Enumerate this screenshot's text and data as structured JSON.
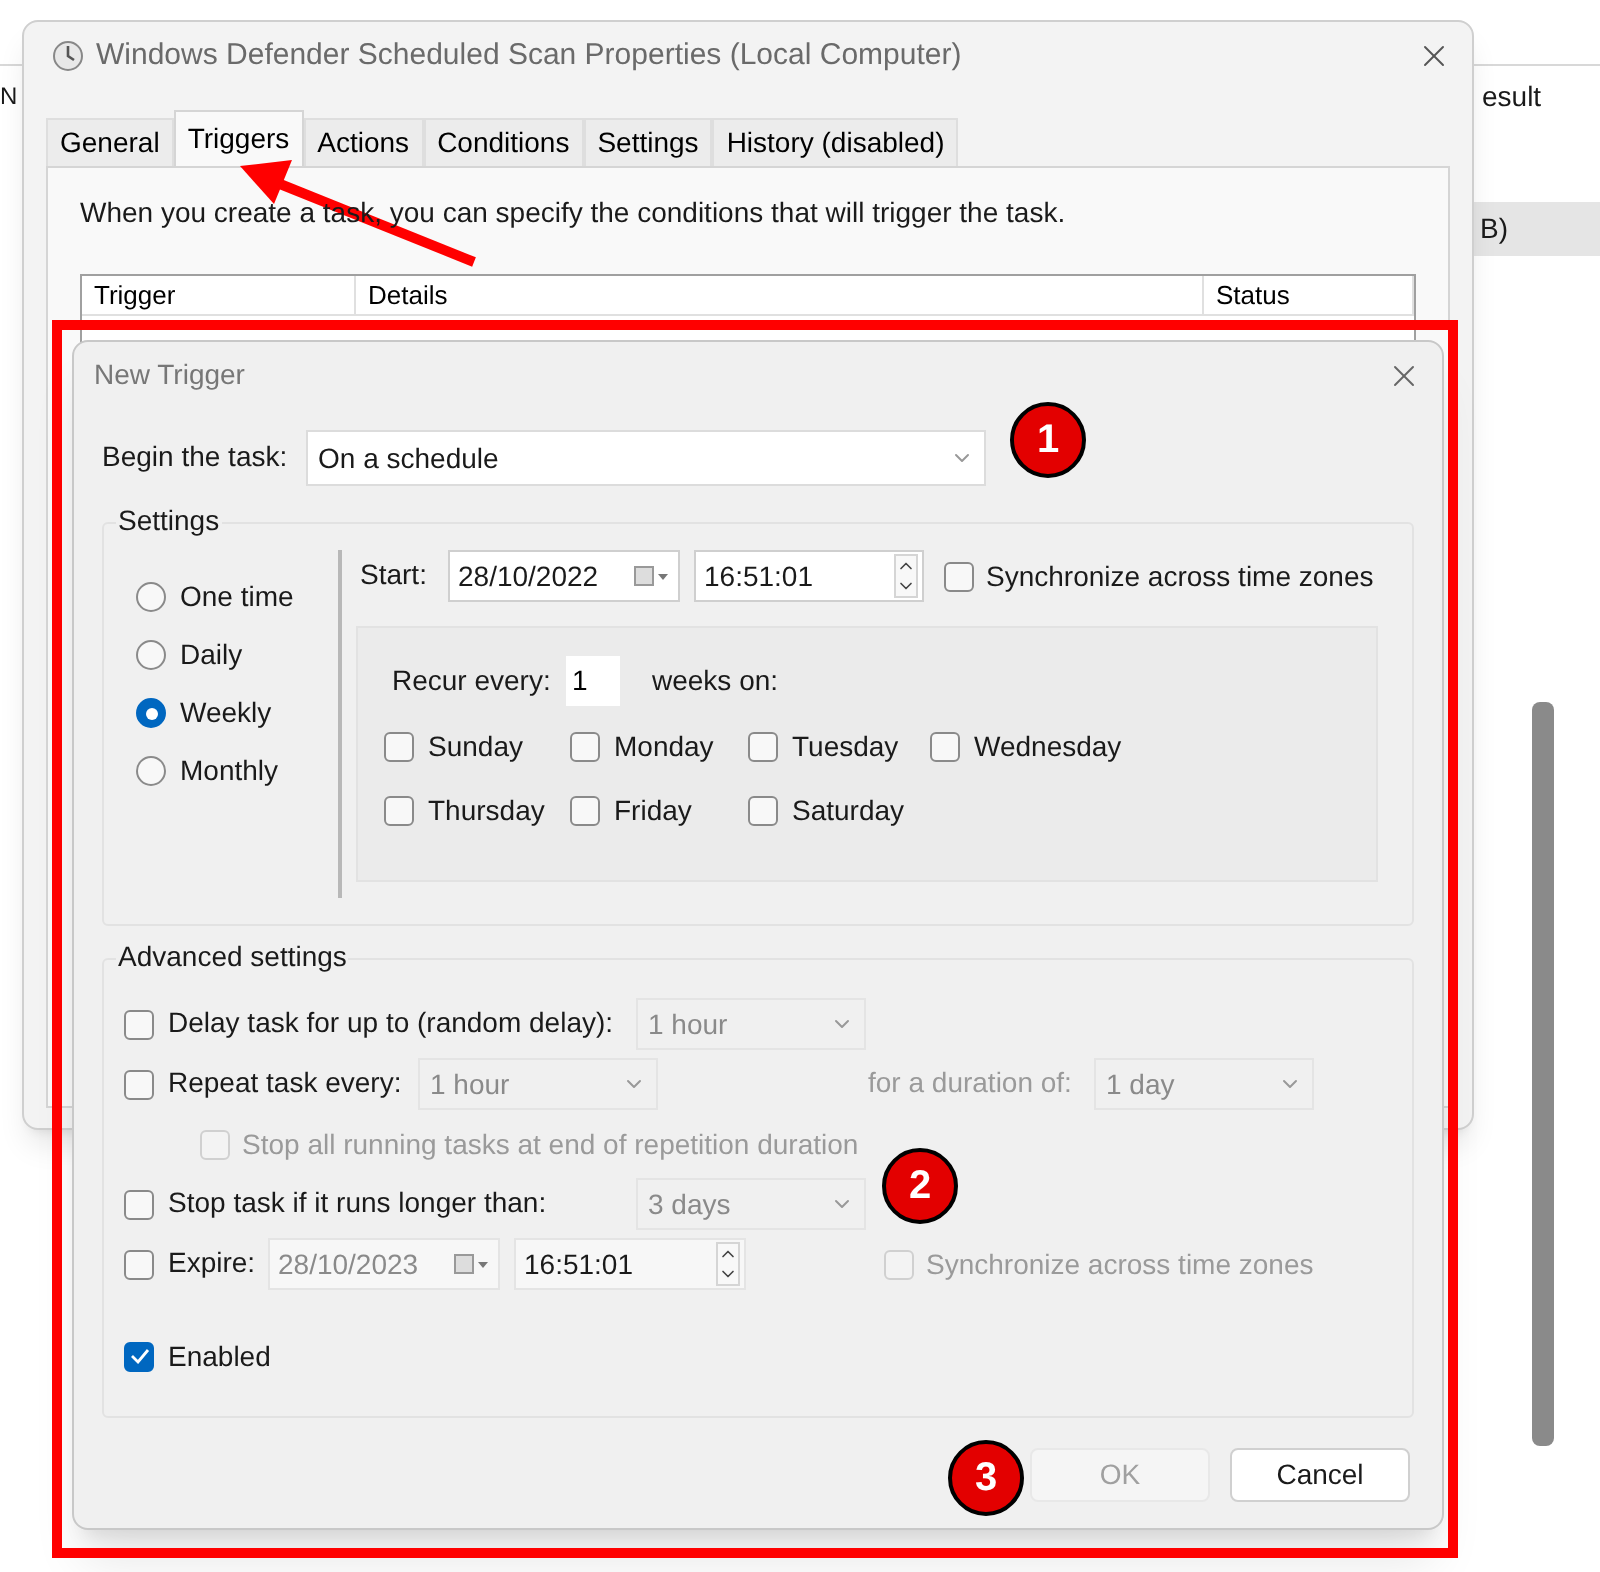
{
  "background_window": {
    "column_heading": "esult",
    "row_cell": "B)",
    "left_heading": "N"
  },
  "properties_window": {
    "title": "Windows Defender Scheduled Scan Properties (Local Computer)",
    "tabs": [
      {
        "label": "General",
        "selected": false
      },
      {
        "label": "Triggers",
        "selected": true
      },
      {
        "label": "Actions",
        "selected": false
      },
      {
        "label": "Conditions",
        "selected": false
      },
      {
        "label": "Settings",
        "selected": false
      },
      {
        "label": "History (disabled)",
        "selected": false
      }
    ],
    "description": "When you create a task, you can specify the conditions that will trigger the task.",
    "table": {
      "columns": [
        "Trigger",
        "Details",
        "Status"
      ]
    }
  },
  "new_trigger": {
    "title": "New Trigger",
    "begin_label": "Begin the task:",
    "begin_value": "On a schedule",
    "settings": {
      "legend": "Settings",
      "schedule_options": [
        {
          "label": "One time",
          "selected": false
        },
        {
          "label": "Daily",
          "selected": false
        },
        {
          "label": "Weekly",
          "selected": true
        },
        {
          "label": "Monthly",
          "selected": false
        }
      ],
      "start_label": "Start:",
      "start_date": "28/10/2022",
      "start_time": "16:51:01",
      "sync": {
        "label": "Synchronize across time zones",
        "checked": false
      },
      "recur_label": "Recur every:",
      "recur_value": "1",
      "recur_unit": "weeks on:",
      "days": [
        {
          "label": "Sunday",
          "checked": false
        },
        {
          "label": "Monday",
          "checked": false
        },
        {
          "label": "Tuesday",
          "checked": false
        },
        {
          "label": "Wednesday",
          "checked": false
        },
        {
          "label": "Thursday",
          "checked": false
        },
        {
          "label": "Friday",
          "checked": false
        },
        {
          "label": "Saturday",
          "checked": false
        }
      ]
    },
    "advanced": {
      "legend": "Advanced settings",
      "delay": {
        "label": "Delay task for up to (random delay):",
        "checked": false,
        "value": "1 hour"
      },
      "repeat": {
        "label": "Repeat task every:",
        "checked": false,
        "value": "1 hour",
        "duration_label": "for a duration of:",
        "duration_value": "1 day"
      },
      "stop_all": {
        "label": "Stop all running tasks at end of repetition duration",
        "checked": false,
        "disabled": true
      },
      "stop_task": {
        "label": "Stop task if it runs longer than:",
        "checked": false,
        "value": "3 days"
      },
      "expire": {
        "label": "Expire:",
        "checked": false,
        "date": "28/10/2023",
        "time": "16:51:01",
        "sync_label": "Synchronize across time zones",
        "sync_checked": false,
        "sync_disabled": true
      },
      "enabled": {
        "label": "Enabled",
        "checked": true
      }
    },
    "buttons": [
      {
        "label": "OK",
        "disabled": true
      },
      {
        "label": "Cancel",
        "disabled": false
      }
    ]
  },
  "annotations": {
    "markers": [
      {
        "label": "1"
      },
      {
        "label": "2"
      },
      {
        "label": "3"
      }
    ]
  }
}
